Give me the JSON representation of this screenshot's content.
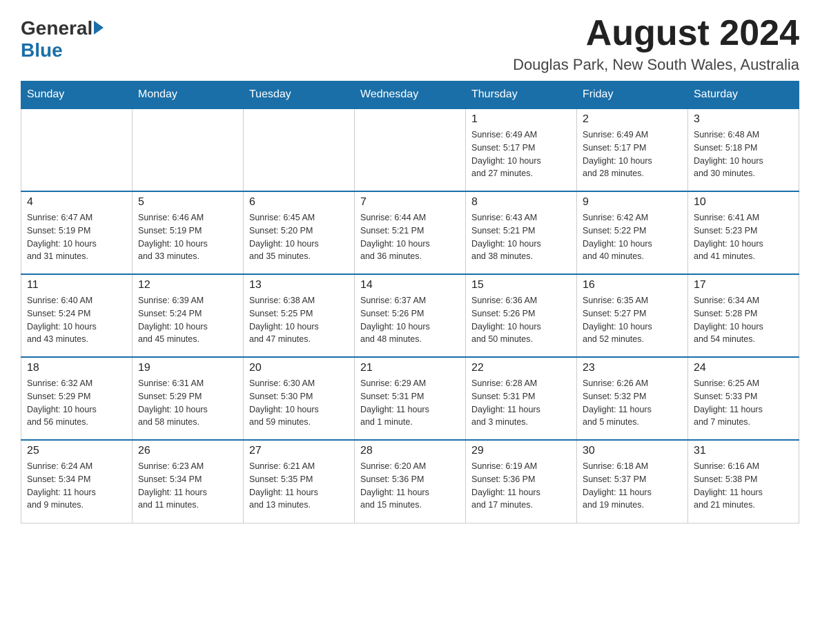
{
  "header": {
    "logo_general": "General",
    "logo_blue": "Blue",
    "month_year": "August 2024",
    "location": "Douglas Park, New South Wales, Australia"
  },
  "calendar": {
    "days_of_week": [
      "Sunday",
      "Monday",
      "Tuesday",
      "Wednesday",
      "Thursday",
      "Friday",
      "Saturday"
    ],
    "weeks": [
      [
        {
          "day": "",
          "info": ""
        },
        {
          "day": "",
          "info": ""
        },
        {
          "day": "",
          "info": ""
        },
        {
          "day": "",
          "info": ""
        },
        {
          "day": "1",
          "info": "Sunrise: 6:49 AM\nSunset: 5:17 PM\nDaylight: 10 hours\nand 27 minutes."
        },
        {
          "day": "2",
          "info": "Sunrise: 6:49 AM\nSunset: 5:17 PM\nDaylight: 10 hours\nand 28 minutes."
        },
        {
          "day": "3",
          "info": "Sunrise: 6:48 AM\nSunset: 5:18 PM\nDaylight: 10 hours\nand 30 minutes."
        }
      ],
      [
        {
          "day": "4",
          "info": "Sunrise: 6:47 AM\nSunset: 5:19 PM\nDaylight: 10 hours\nand 31 minutes."
        },
        {
          "day": "5",
          "info": "Sunrise: 6:46 AM\nSunset: 5:19 PM\nDaylight: 10 hours\nand 33 minutes."
        },
        {
          "day": "6",
          "info": "Sunrise: 6:45 AM\nSunset: 5:20 PM\nDaylight: 10 hours\nand 35 minutes."
        },
        {
          "day": "7",
          "info": "Sunrise: 6:44 AM\nSunset: 5:21 PM\nDaylight: 10 hours\nand 36 minutes."
        },
        {
          "day": "8",
          "info": "Sunrise: 6:43 AM\nSunset: 5:21 PM\nDaylight: 10 hours\nand 38 minutes."
        },
        {
          "day": "9",
          "info": "Sunrise: 6:42 AM\nSunset: 5:22 PM\nDaylight: 10 hours\nand 40 minutes."
        },
        {
          "day": "10",
          "info": "Sunrise: 6:41 AM\nSunset: 5:23 PM\nDaylight: 10 hours\nand 41 minutes."
        }
      ],
      [
        {
          "day": "11",
          "info": "Sunrise: 6:40 AM\nSunset: 5:24 PM\nDaylight: 10 hours\nand 43 minutes."
        },
        {
          "day": "12",
          "info": "Sunrise: 6:39 AM\nSunset: 5:24 PM\nDaylight: 10 hours\nand 45 minutes."
        },
        {
          "day": "13",
          "info": "Sunrise: 6:38 AM\nSunset: 5:25 PM\nDaylight: 10 hours\nand 47 minutes."
        },
        {
          "day": "14",
          "info": "Sunrise: 6:37 AM\nSunset: 5:26 PM\nDaylight: 10 hours\nand 48 minutes."
        },
        {
          "day": "15",
          "info": "Sunrise: 6:36 AM\nSunset: 5:26 PM\nDaylight: 10 hours\nand 50 minutes."
        },
        {
          "day": "16",
          "info": "Sunrise: 6:35 AM\nSunset: 5:27 PM\nDaylight: 10 hours\nand 52 minutes."
        },
        {
          "day": "17",
          "info": "Sunrise: 6:34 AM\nSunset: 5:28 PM\nDaylight: 10 hours\nand 54 minutes."
        }
      ],
      [
        {
          "day": "18",
          "info": "Sunrise: 6:32 AM\nSunset: 5:29 PM\nDaylight: 10 hours\nand 56 minutes."
        },
        {
          "day": "19",
          "info": "Sunrise: 6:31 AM\nSunset: 5:29 PM\nDaylight: 10 hours\nand 58 minutes."
        },
        {
          "day": "20",
          "info": "Sunrise: 6:30 AM\nSunset: 5:30 PM\nDaylight: 10 hours\nand 59 minutes."
        },
        {
          "day": "21",
          "info": "Sunrise: 6:29 AM\nSunset: 5:31 PM\nDaylight: 11 hours\nand 1 minute."
        },
        {
          "day": "22",
          "info": "Sunrise: 6:28 AM\nSunset: 5:31 PM\nDaylight: 11 hours\nand 3 minutes."
        },
        {
          "day": "23",
          "info": "Sunrise: 6:26 AM\nSunset: 5:32 PM\nDaylight: 11 hours\nand 5 minutes."
        },
        {
          "day": "24",
          "info": "Sunrise: 6:25 AM\nSunset: 5:33 PM\nDaylight: 11 hours\nand 7 minutes."
        }
      ],
      [
        {
          "day": "25",
          "info": "Sunrise: 6:24 AM\nSunset: 5:34 PM\nDaylight: 11 hours\nand 9 minutes."
        },
        {
          "day": "26",
          "info": "Sunrise: 6:23 AM\nSunset: 5:34 PM\nDaylight: 11 hours\nand 11 minutes."
        },
        {
          "day": "27",
          "info": "Sunrise: 6:21 AM\nSunset: 5:35 PM\nDaylight: 11 hours\nand 13 minutes."
        },
        {
          "day": "28",
          "info": "Sunrise: 6:20 AM\nSunset: 5:36 PM\nDaylight: 11 hours\nand 15 minutes."
        },
        {
          "day": "29",
          "info": "Sunrise: 6:19 AM\nSunset: 5:36 PM\nDaylight: 11 hours\nand 17 minutes."
        },
        {
          "day": "30",
          "info": "Sunrise: 6:18 AM\nSunset: 5:37 PM\nDaylight: 11 hours\nand 19 minutes."
        },
        {
          "day": "31",
          "info": "Sunrise: 6:16 AM\nSunset: 5:38 PM\nDaylight: 11 hours\nand 21 minutes."
        }
      ]
    ]
  }
}
